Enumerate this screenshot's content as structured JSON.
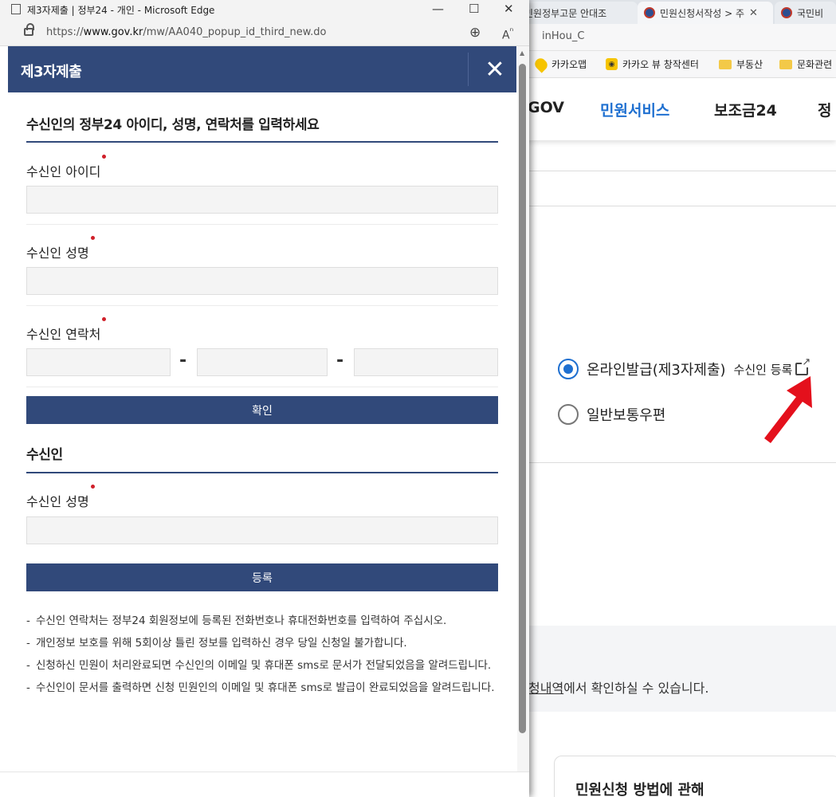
{
  "background": {
    "tabs": [
      {
        "label": "민원정부고문 안대조"
      },
      {
        "label": "민원신청서작성 > 주"
      },
      {
        "label": "국민비"
      }
    ],
    "address_fragment": "inHou_C",
    "bookmarks": [
      {
        "label": "카카오맵",
        "icon": "kakaomap-pin-icon"
      },
      {
        "label": "카카오 뷰 창작센터",
        "icon": "kakao-view-icon"
      },
      {
        "label": "부동산",
        "icon": "folder-icon"
      },
      {
        "label": "문화관련",
        "icon": "folder-icon"
      }
    ],
    "gnb": {
      "items": [
        {
          "label": "GOV"
        },
        {
          "label": "민원서비스"
        },
        {
          "label": "보조금24"
        },
        {
          "label": "정"
        }
      ]
    },
    "options": {
      "online": "온라인발급(제3자제출)",
      "recipient_register": "수신인 등록",
      "mail": "일반보통우편"
    },
    "history_link": "청내역",
    "history_suffix": "에서 확인하실 수 있습니다.",
    "card_title": "민원신청 방법에 관해"
  },
  "popup": {
    "window_title": "제3자제출 | 정부24 - 개인 - Microsoft Edge",
    "url_prefix": "https://",
    "url_domain": "www.gov.kr",
    "url_path": "/mw/AA040_popup_id_third_new.do",
    "header_title": "제3자제출",
    "close_label": "✕",
    "section1_title": "수신인의 정부24 아이디, 성명, 연락처를 입력하세요",
    "label_id": "수신인 아이디",
    "label_name": "수신인 성명",
    "label_phone": "수신인 연락처",
    "phone_separator": "-",
    "confirm_button": "확인",
    "section2_title": "수신인",
    "label_name2": "수신인 성명",
    "register_button": "등록",
    "notices": [
      "수신인 연락처는 정부24 회원정보에 등록된 전화번호나 휴대전화번호를 입력하여 주십시오.",
      "개인정보 보호를 위해 5회이상 틀린 정보를 입력하신 경우 당일 신청일 불가합니다.",
      "신청하신 민원이 처리완료되면 수신인의 이메일 및 휴대폰 sms로 문서가 전달되었음을 알려드립니다.",
      "수신인이 문서를 출력하면 신청 민원인의 이메일 및 휴대폰 sms로 발급이 완료되었음을 알려드립니다."
    ]
  },
  "colors": {
    "header_bg": "#31497a",
    "accent_blue": "#1e6fd0",
    "required_dot": "#d0202a",
    "annotation_arrow": "#e4101c"
  }
}
